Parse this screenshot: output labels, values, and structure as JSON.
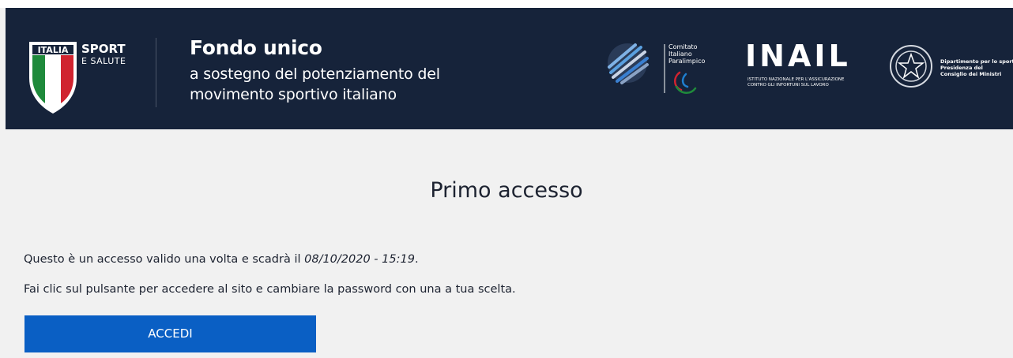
{
  "header": {
    "brand": {
      "line1": "ITALIA",
      "line2": "SPORT",
      "line3": "E SALUTE"
    },
    "title": "Fondo unico",
    "subtitle_line1": "a sostegno del potenziamento del",
    "subtitle_line2": "movimento sportivo italiano",
    "partners": {
      "cip": {
        "line1": "Comitato",
        "line2": "Italiano",
        "line3": "Paralimpico"
      },
      "inail": {
        "name": "INAIL",
        "line1": "ISTITUTO NAZIONALE PER L'ASSICURAZIONE",
        "line2": "CONTRO GLI INFORTUNI SUL LAVORO"
      },
      "dipartimento": {
        "line1": "Dipartimento per lo sport",
        "line2": "Presidenza del",
        "line3": "Consiglio dei Ministri"
      }
    },
    "colors": {
      "background": "#16233a",
      "flag_green": "#1f8a3b",
      "flag_red": "#d0232f"
    }
  },
  "main": {
    "title": "Primo accesso",
    "message_prefix": "Questo è un accesso valido una volta e scadrà il ",
    "expiry": "08/10/2020 - 15:19",
    "message_suffix": ".",
    "instruction": "Fai clic sul pulsante per accedere al sito e cambiare la password con una a tua scelta.",
    "button_label": "ACCEDI",
    "button_color": "#0a5fc4"
  }
}
